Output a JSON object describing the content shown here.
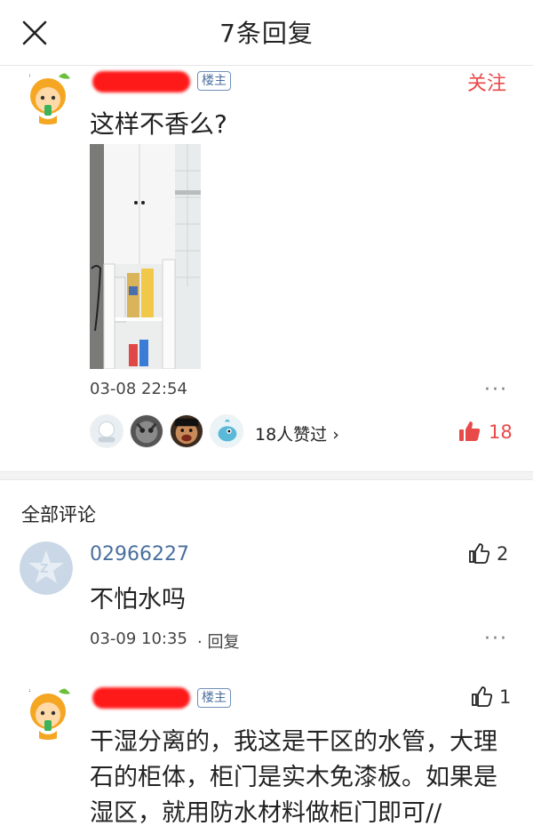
{
  "header": {
    "title": "7条回复",
    "close_icon": "close-icon"
  },
  "main_post": {
    "owner_badge": "楼主",
    "follow_label": "关注",
    "text": "这样不香么?",
    "timestamp": "03-08 22:54",
    "more_label": "···",
    "likers_text": "18人赞过 ›",
    "like_count": "18",
    "like_color": "#e84a4a"
  },
  "comments_section": {
    "title": "全部评论"
  },
  "comments": [
    {
      "username": "02966227",
      "like_count": "2",
      "text": "不怕水吗",
      "timestamp": "03-09 10:35",
      "reply_label": "· 回复",
      "more_label": "···"
    },
    {
      "owner_badge": "楼主",
      "like_count": "1",
      "text_lines": [
        "干湿分离的，我这是干区的水管，大理",
        "石的柜体，柜门是实木免漆板。如果是",
        "湿区，就用防水材料做柜门即可//"
      ]
    }
  ],
  "colors": {
    "accent": "#e84a4a",
    "username": "#4a6f9e",
    "badge_border": "#6f8fb8"
  }
}
